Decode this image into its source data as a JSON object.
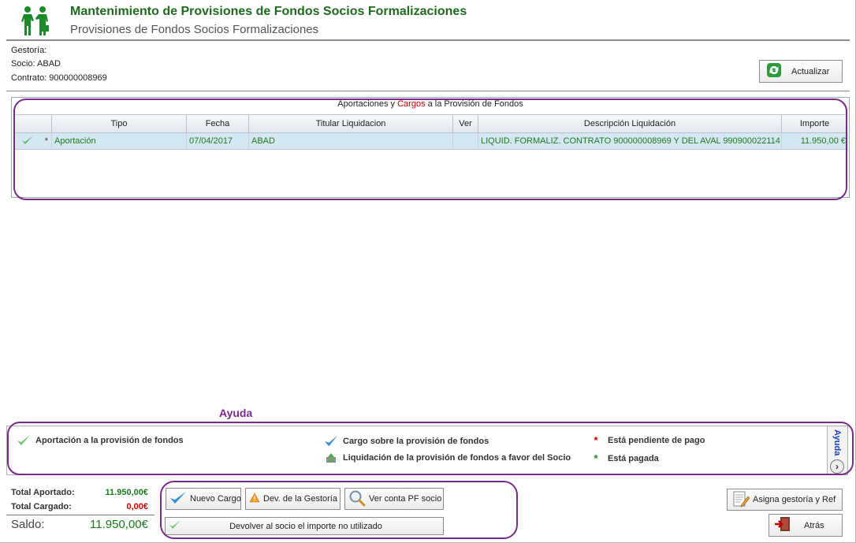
{
  "header": {
    "title": "Mantenimiento de Provisiones de Fondos Socios Formalizaciones",
    "subtitle": "Provisiones de Fondos Socios Formalizaciones",
    "logo_icon": "business-handshake-icon"
  },
  "info": {
    "gestoria": "Gestoría:",
    "socio": "Socio: ABAD",
    "contrato": "Contrato: 900000008969"
  },
  "toolbar": {
    "actualizar_label": "Actualizar"
  },
  "grid": {
    "caption_part1": "Aportaciones y ",
    "caption_part2": "Cargos",
    "caption_part3": " a la Provisión de Fondos",
    "columns": [
      "",
      "Tipo",
      "Fecha",
      "Titular Liquidacion",
      "Ver",
      "Descripción Liquidación",
      "Importe"
    ],
    "rows": [
      {
        "marker": "*",
        "tipo": "Aportación",
        "fecha": "07/04/2017",
        "titular": "ABAD",
        "ver": "",
        "descripcion": "LIQUID. FORMALIZ. CONTRATO 900000008969 Y DEL AVAL 990900022114",
        "importe": "11.950,00 €"
      }
    ]
  },
  "help": {
    "title": "Ayuda",
    "side_label": "Ayuda",
    "items": [
      "Aportación a la provisión de fondos",
      "Cargo sobre la provisión de fondos",
      "Liquidación de la provisión de fondos a favor del Socio",
      "Está pendiente de pago",
      "Está pagada"
    ]
  },
  "totals": {
    "aportado_label": "Total Aportado:",
    "aportado_value": "11.950,00€",
    "cargado_label": "Total Cargado:",
    "cargado_value": "0,00€",
    "saldo_label": "Saldo:",
    "saldo_value": "11.950,00€"
  },
  "actions": {
    "nuevo_cargo": "Nuevo Cargo",
    "dev_gestoria": "Dev. de la Gestoría",
    "ver_conta": "Ver conta PF socio",
    "devolver": "Devolver al socio el importe no utilizado",
    "asigna": "Asigna gestoría y Ref",
    "atras": "Atrás"
  },
  "colors": {
    "title_green": "#1f6a1f",
    "value_green": "#1b7a1b",
    "value_red": "#cc0000",
    "highlight_purple": "#7a2a8a",
    "row_selected": "#d6e7f4"
  }
}
